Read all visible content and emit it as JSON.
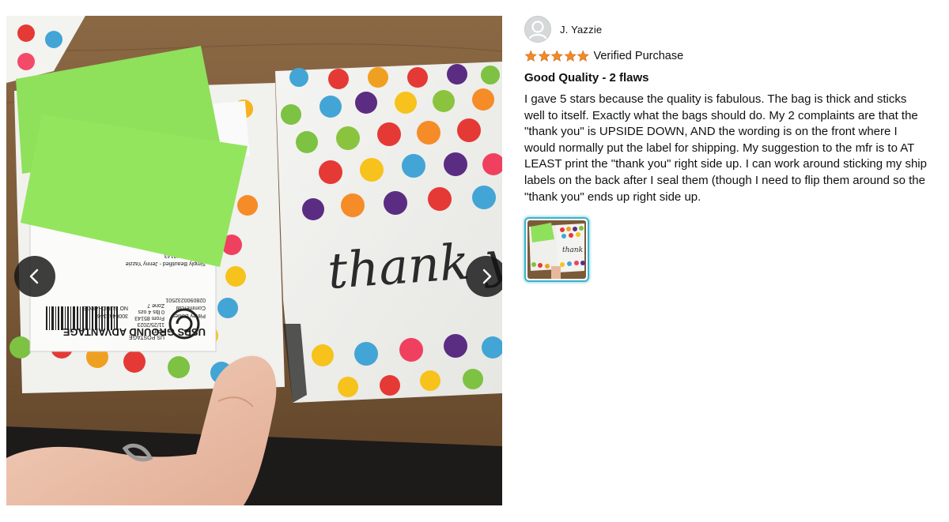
{
  "reviewer": {
    "name": "J. Yazzie",
    "avatar_icon": "user-silhouette-icon"
  },
  "rating": {
    "stars": 5,
    "max": 5,
    "star_color": "#f08a24"
  },
  "badge": {
    "verified": "Verified Purchase"
  },
  "review": {
    "title": "Good Quality - 2 flaws",
    "body": "I gave 5 stars because the quality is fabulous. The bag is thick and sticks well to itself. Exactly what the bags should do. My 2 complaints are that the \"thank you\" is UPSIDE DOWN, AND the wording is on the front where I would normally put the label for shipping. My suggestion to the mfr is to AT LEAST print the \"thank you\" right side up. I can work around sticking my ship labels on the back after I seal them (though I need to flip them around so the \"thank you\" ends up right side up."
  },
  "photo": {
    "bag_text": "thank yo",
    "label_service": "USPS GROUND ADVANTAGE",
    "label_postage": "US POSTAGE",
    "label_paid": "PAID",
    "label_date": "11/25/2023",
    "label_from": "From 85143",
    "label_zone": "Zone 7",
    "label_weight": "0 lbs 4 ozs",
    "label_commercial": "Commercial",
    "label_surcharge": "NO SURCHARGE",
    "label_ref": "0280900232501",
    "label_code": "3000462346",
    "label_shipper": "Pitney Bowes",
    "label_sender": "Simply Beautified - Jenny Yazzie",
    "label_address": "4 Lane Dr #8143",
    "label_num": "0002",
    "nav_prev_icon": "chevron-left-icon",
    "nav_next_icon": "chevron-right-icon"
  },
  "thumbnail": {
    "label": "thank you"
  },
  "colors": {
    "accent_border": "#3bb3c8",
    "nav_bg": "#141414"
  }
}
